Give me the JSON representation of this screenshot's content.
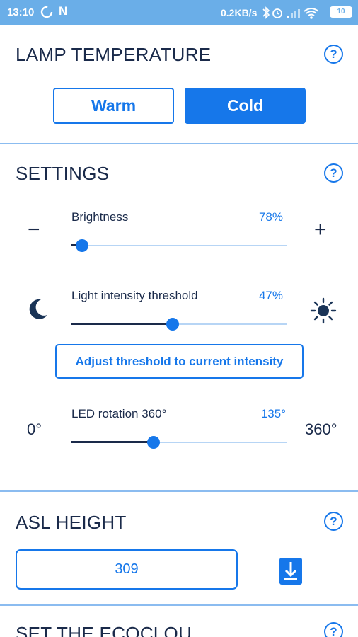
{
  "status_bar": {
    "time": "13:10",
    "n_icon": "N",
    "network_speed": "0.2KB/s",
    "battery": "10",
    "icons": [
      "sync-icon",
      "bluetooth-icon",
      "alarm-icon",
      "signal-icon",
      "wifi-icon",
      "battery-icon"
    ]
  },
  "colors": {
    "accent": "#1677ea",
    "status_bar": "#6aaee8",
    "text": "#1a2a4a",
    "divider": "#8bbcf0"
  },
  "lamp_temperature": {
    "title": "LAMP TEMPERATURE",
    "help": "?",
    "options": [
      "Warm",
      "Cold"
    ],
    "selected": "Cold"
  },
  "settings": {
    "title": "SETTINGS",
    "help": "?",
    "brightness": {
      "label": "Brightness",
      "value_text": "78%",
      "decrease": "−",
      "increase": "+",
      "slider_fraction": 0.05
    },
    "threshold": {
      "label": "Light intensity threshold",
      "value_text": "47%",
      "slider_fraction": 0.47,
      "left_icon": "moon-icon",
      "right_icon": "sun-icon"
    },
    "adjust_button": "Adjust threshold to current intensity",
    "rotation": {
      "label": "LED rotation 360°",
      "value_text": "135°",
      "min_label": "0°",
      "max_label": "360°",
      "slider_fraction": 0.38
    }
  },
  "asl_height": {
    "title": "ASL HEIGHT",
    "help": "?",
    "value": "309",
    "download_icon": "download-icon"
  },
  "next_section": {
    "title": "SET THE ECOCLOU",
    "help": "?"
  }
}
